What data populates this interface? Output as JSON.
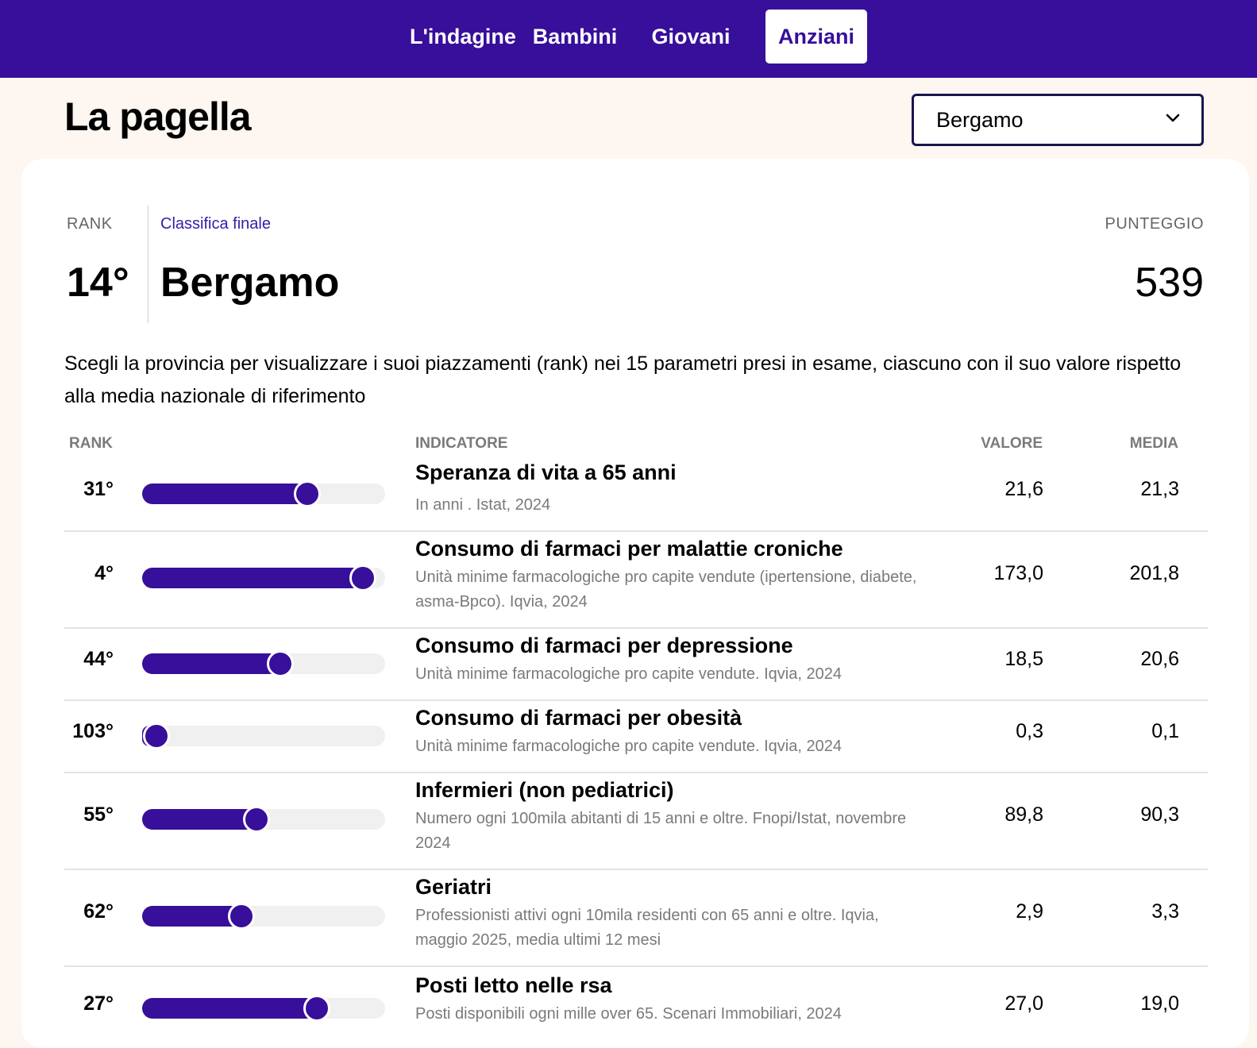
{
  "nav": {
    "items": [
      {
        "label": "L'indagine",
        "active": false
      },
      {
        "label": "Bambini",
        "active": false
      },
      {
        "label": "Giovani",
        "active": false
      },
      {
        "label": "Anziani",
        "active": true
      }
    ]
  },
  "page": {
    "title": "La pagella"
  },
  "province_select": {
    "value": "Bergamo",
    "icon": "chevron-down-icon"
  },
  "summary": {
    "rank_label": "RANK",
    "link_label": "Classifica finale",
    "score_label": "PUNTEGGIO",
    "rank": "14°",
    "province": "Bergamo",
    "score": "539"
  },
  "description": "Scegli la provincia per visualizzare i suoi piazzamenti (rank) nei 15 parametri presi in esame, ciascuno con il suo valore rispetto alla media nazionale di riferimento",
  "table": {
    "headers": {
      "rank": "RANK",
      "indicator": "INDICATORE",
      "value": "VALORE",
      "average": "MEDIA"
    },
    "rows": [
      {
        "rank": "31°",
        "level": 0.68,
        "title": "Speranza di vita a 65 anni",
        "subtitle": "In anni . Istat, 2024",
        "value": "21,6",
        "average": "21,3"
      },
      {
        "rank": "4°",
        "level": 0.91,
        "title": "Consumo di farmaci per malattie croniche",
        "subtitle": "Unità minime farmacologiche pro capite vendute (ipertensione, diabete, asma-Bpco). Iqvia, 2024",
        "value": "173,0",
        "average": "201,8"
      },
      {
        "rank": "44°",
        "level": 0.57,
        "title": "Consumo di farmaci per depressione",
        "subtitle": "Unità minime farmacologiche pro capite vendute. Iqvia, 2024",
        "value": "18,5",
        "average": "20,6"
      },
      {
        "rank": "103°",
        "level": 0.06,
        "title": "Consumo di farmaci per obesità",
        "subtitle": "Unità minime farmacologiche pro capite vendute. Iqvia, 2024",
        "value": "0,3",
        "average": "0,1"
      },
      {
        "rank": "55°",
        "level": 0.47,
        "title": "Infermieri (non pediatrici)",
        "subtitle": "Numero ogni 100mila abitanti di 15 anni e oltre. Fnopi/Istat, novembre 2024",
        "value": "89,8",
        "average": "90,3"
      },
      {
        "rank": "62°",
        "level": 0.41,
        "title": "Geriatri",
        "subtitle": "Professionisti attivi ogni 10mila residenti con 65 anni e oltre. Iqvia, maggio 2025, media ultimi 12 mesi",
        "value": "2,9",
        "average": "3,3"
      },
      {
        "rank": "27°",
        "level": 0.72,
        "title": "Posti letto nelle rsa",
        "subtitle": "Posti disponibili ogni mille over 65. Scenari Immobiliari, 2024",
        "value": "27,0",
        "average": "19,0"
      }
    ]
  }
}
